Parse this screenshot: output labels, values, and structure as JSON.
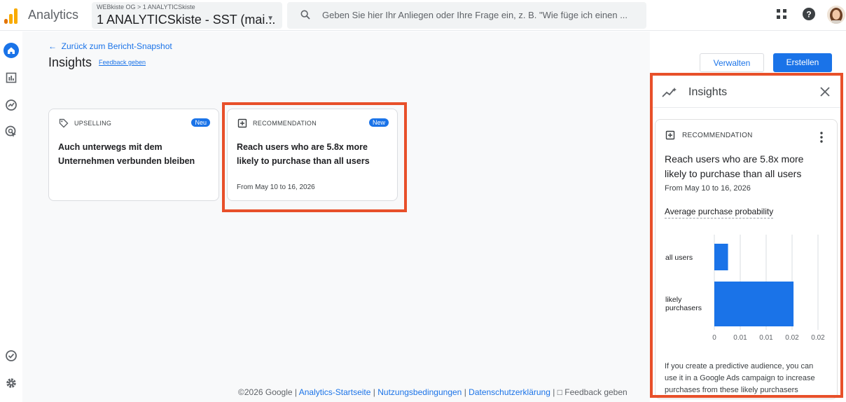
{
  "app": {
    "title": "Analytics",
    "property_breadcrumb": "WEBkiste OG > 1 ANALYTICSkiste",
    "property_name": "1 ANALYTICSkiste - SST (mai...",
    "search_placeholder": "Geben Sie hier Ihr Anliegen oder Ihre Frage ein, z. B. \"Wie füge ich einen ..."
  },
  "page": {
    "back_link": "Zurück zum Bericht-Snapshot",
    "title": "Insights",
    "feedback_link": "Feedback geben",
    "manage_button": "Verwalten",
    "create_button": "Erstellen"
  },
  "cards": [
    {
      "type": "UPSELLING",
      "badge": "Neu",
      "text": "Auch unterwegs mit dem Unternehmen verbunden bleiben",
      "icon": "tag-icon"
    },
    {
      "type": "RECOMMENDATION",
      "badge": "New",
      "text": "Reach users who are 5.8x more likely to purchase than all users",
      "date": "From May 10 to 16, 2026",
      "icon": "add-box-icon"
    }
  ],
  "footer": {
    "copyright": "©2026 Google",
    "sep": "|",
    "link_home": "Analytics-Startseite",
    "link_terms": "Nutzungsbedingungen",
    "link_privacy": "Datenschutzerklärung",
    "feedback": "Feedback geben"
  },
  "panel": {
    "title": "Insights",
    "card_type": "RECOMMENDATION",
    "card_text": "Reach users who are 5.8x more likely to purchase than all users",
    "card_date": "From May 10 to 16, 2026",
    "metric_label": "Average purchase probability",
    "description": "If you create a predictive audience, you can use it in a Google Ads campaign to increase purchases from these likely purchasers"
  },
  "chart_data": {
    "type": "bar",
    "orientation": "horizontal",
    "categories": [
      "all users",
      "likely purchasers"
    ],
    "values": [
      0.0033,
      0.0191
    ],
    "xticks": [
      "0",
      "0.01",
      "0.01",
      "0.02",
      "0.02"
    ],
    "xlim": [
      0,
      0.025
    ],
    "grid": true,
    "bar_color": "#1a73e8"
  },
  "colors": {
    "accent": "#1a73e8",
    "highlight": "#e8502a"
  }
}
